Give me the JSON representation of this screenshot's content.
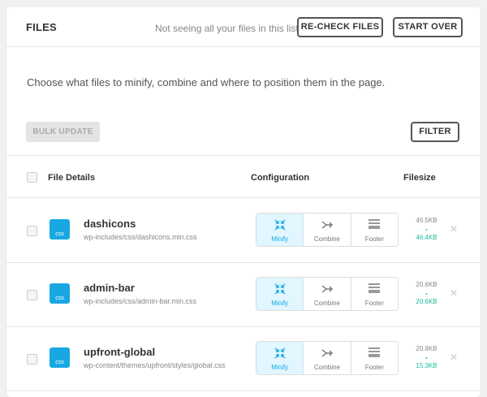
{
  "header": {
    "title": "FILES",
    "hint": "Not seeing all your files in this list?",
    "recheck_label": "RE-CHECK FILES",
    "start_over_label": "START OVER"
  },
  "description": "Choose what files to minify, combine and where to position them in the page.",
  "toolbar": {
    "bulk_update_label": "BULK UPDATE",
    "filter_label": "FILTER"
  },
  "table": {
    "headers": {
      "file_details": "File Details",
      "configuration": "Configuration",
      "filesize": "Filesize"
    },
    "config_labels": {
      "minify": "Minify",
      "combine": "Combine",
      "footer": "Footer"
    },
    "rows": [
      {
        "type": "css",
        "name": "dashicons",
        "path": "wp-includes/css/dashicons.min.css",
        "size_original": "46.5KB",
        "size_new": "46.4KB",
        "minify_active": true
      },
      {
        "type": "css",
        "name": "admin-bar",
        "path": "wp-includes/css/admin-bar.min.css",
        "size_original": "20.6KB",
        "size_new": "20.6KB",
        "minify_active": true
      },
      {
        "type": "css",
        "name": "upfront-global",
        "path": "wp-content/themes/upfront/styles/global.css",
        "size_original": "20.8KB",
        "size_new": "15.3KB",
        "minify_active": true
      }
    ]
  },
  "colors": {
    "accent": "#17a8e3",
    "success": "#1abc9c",
    "active_bg": "#e1f6ff"
  },
  "icons": {
    "minify": "compress-icon",
    "combine": "merge-arrow-icon",
    "footer": "footer-position-icon",
    "size_change": "chevron-down-icon",
    "remove": "close-icon"
  }
}
